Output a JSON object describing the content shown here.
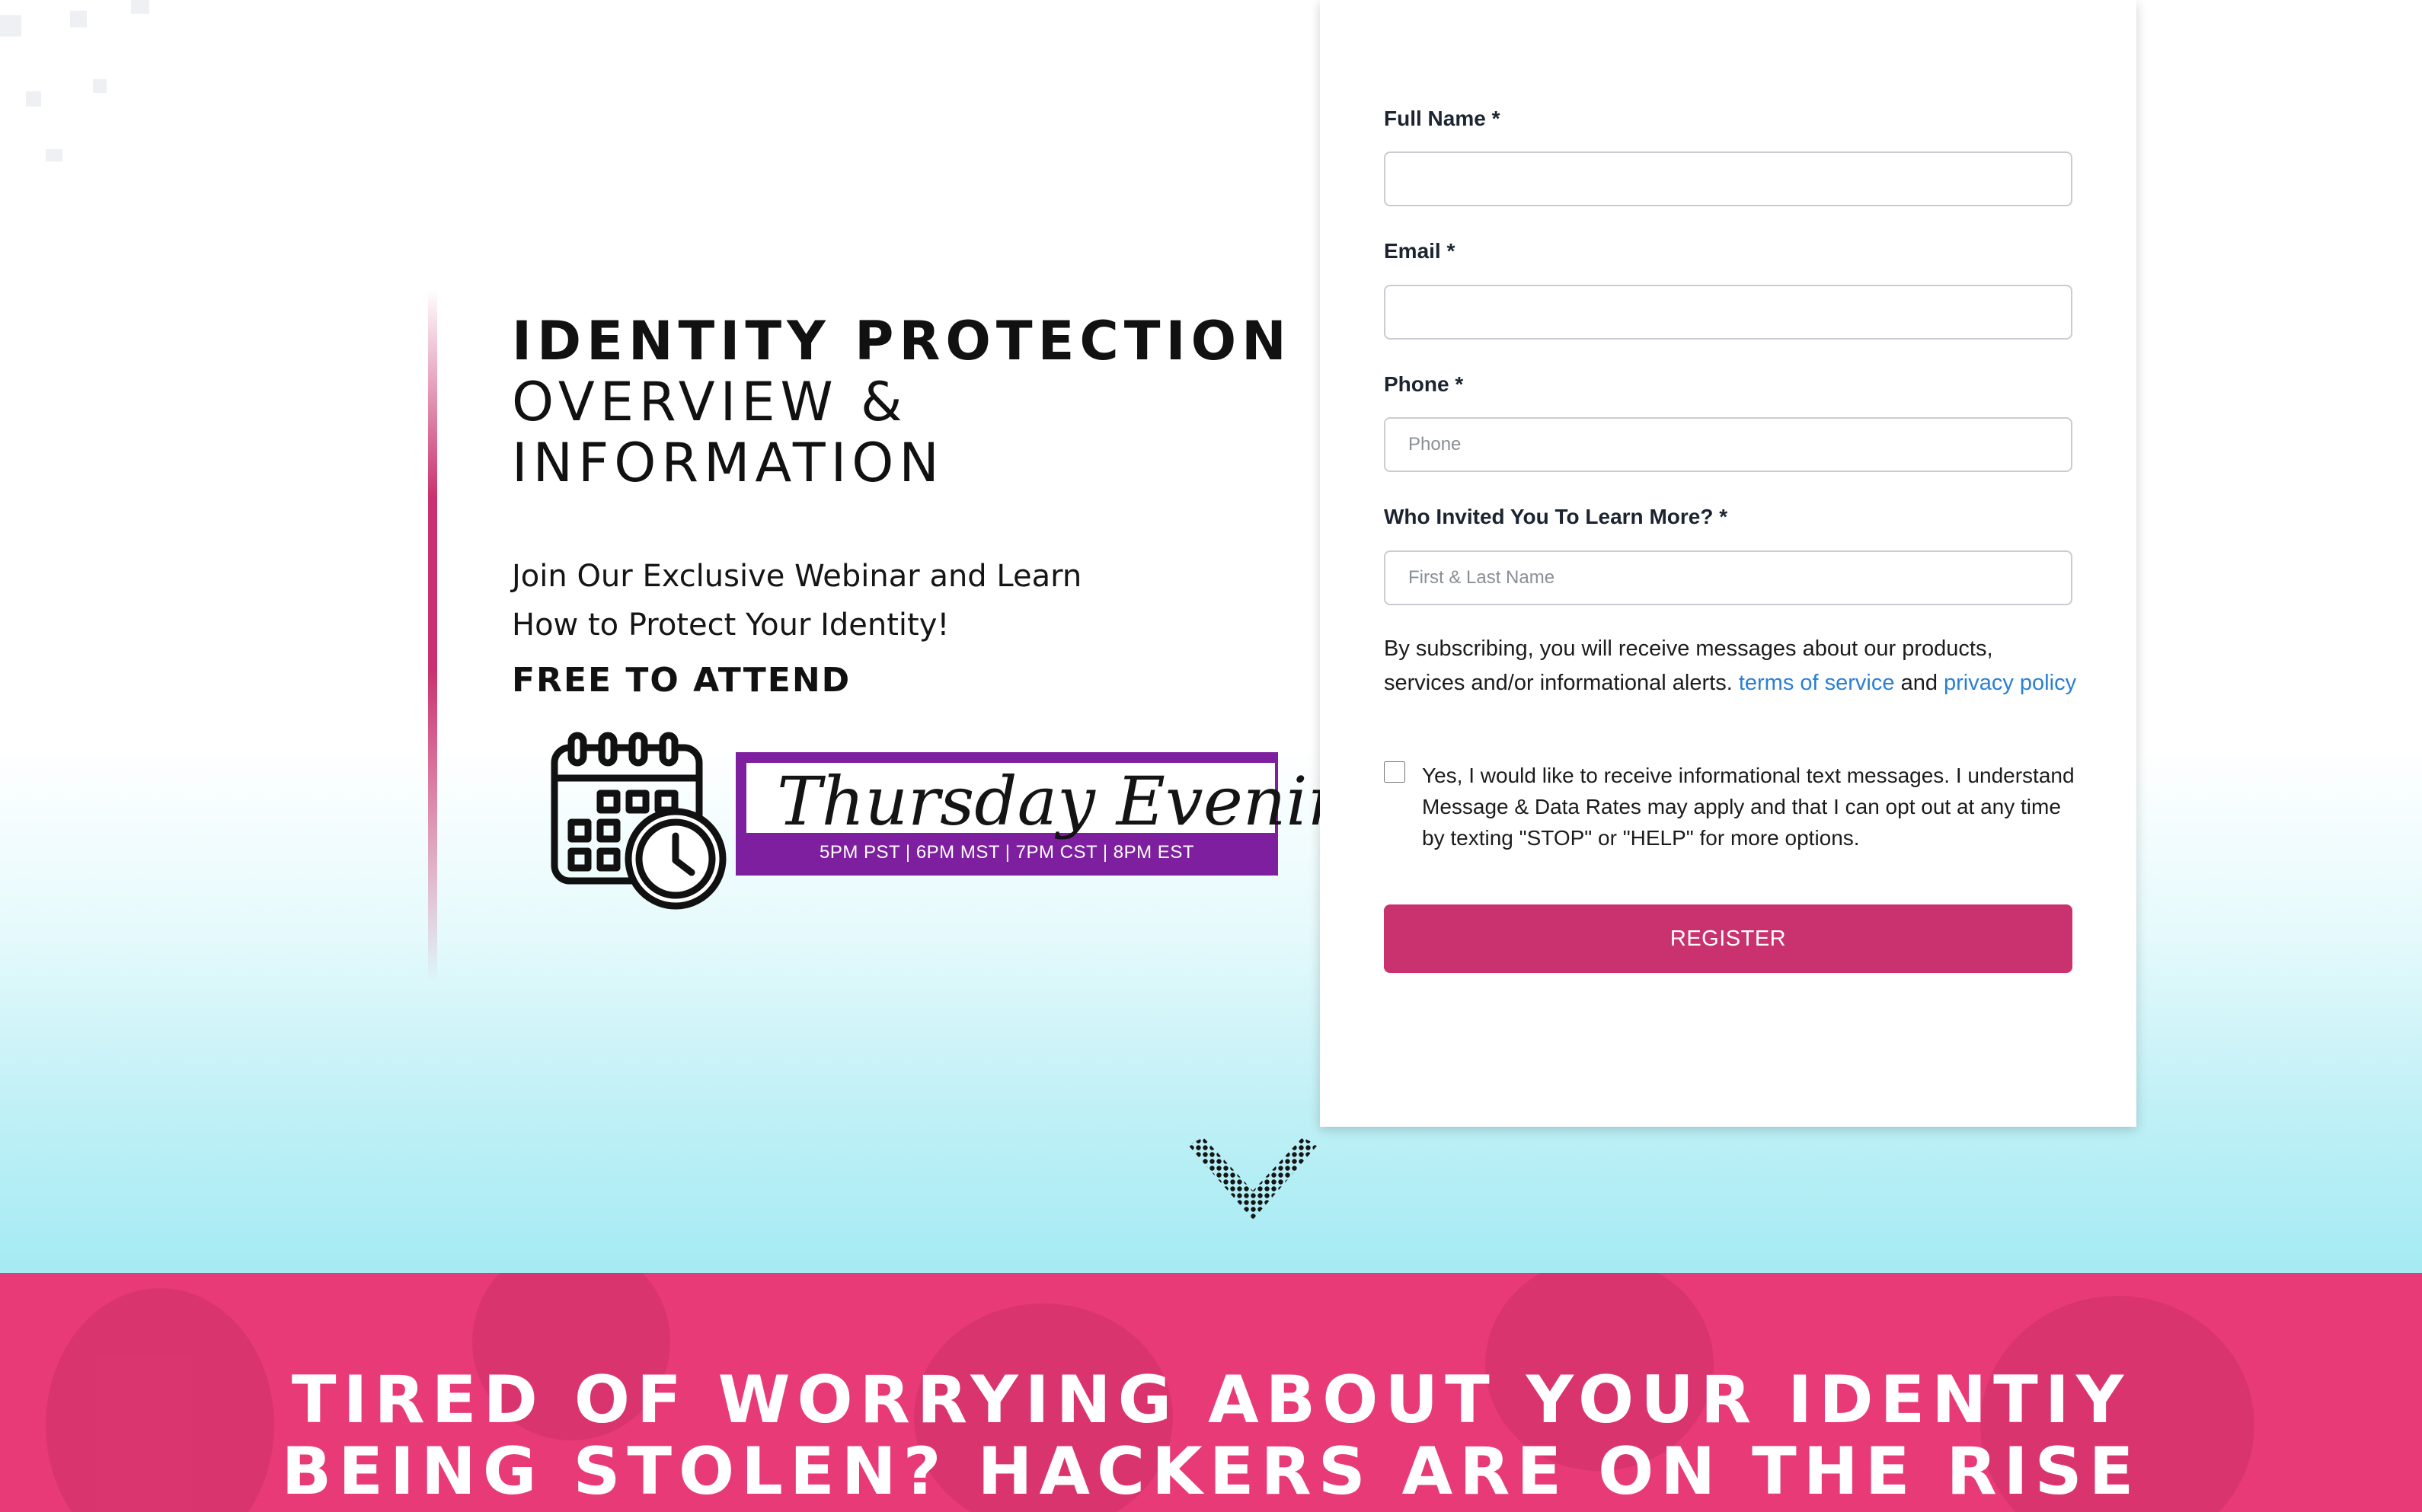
{
  "hero": {
    "title_bold": "IDENTITY PROTECTION",
    "title_line2": "OVERVIEW &",
    "title_line3": "INFORMATION",
    "subtitle_line1": "Join Our Exclusive Webinar and Learn",
    "subtitle_line2": "How to Protect Your Identity!",
    "free_label": "FREE TO ATTEND",
    "schedule": {
      "day_script": "Thursday Evening",
      "times": "5PM PST | 6PM MST | 7PM CST | 8PM EST",
      "banner_color": "#7d1f9e"
    },
    "accent_color": "#c9326e"
  },
  "form": {
    "full_name_label": "Full Name *",
    "full_name_value": "",
    "email_label": "Email *",
    "email_value": "",
    "phone_label": "Phone *",
    "phone_placeholder": "Phone",
    "inviter_label": "Who Invited You To Learn More? *",
    "inviter_placeholder": "First & Last Name",
    "consent_text": "By subscribing, you will receive messages about our products, services and/or informational alerts.",
    "consent_link_terms": "terms of service",
    "consent_and": "and",
    "consent_link_privacy": "privacy policy",
    "sms_opt_in_text": "Yes, I would like to receive informational text messages. I understand Message & Data Rates may apply and that I can opt out at any time by texting \"STOP\" or \"HELP\" for more options.",
    "sms_opt_in_checked": false,
    "register_label": "REGISTER",
    "button_color": "#c9326e",
    "link_color": "#2a7fd4"
  },
  "icons": {
    "calendar": "calendar-clock-icon",
    "scroll_down": "chevron-down-icon"
  },
  "banner": {
    "line1": "TIRED OF WORRYING ABOUT YOUR IDENTIY",
    "line2": "BEING STOLEN? HACKERS ARE ON THE RISE",
    "background_color": "#e93a78"
  }
}
